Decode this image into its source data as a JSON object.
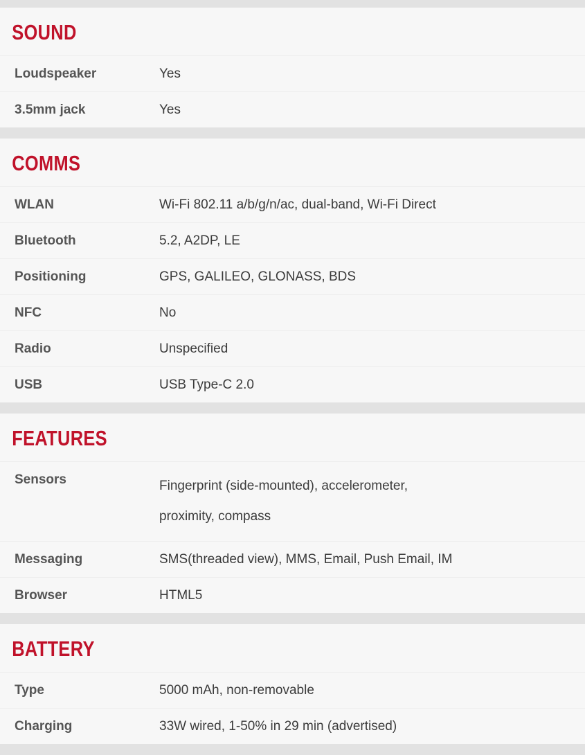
{
  "theme": {
    "accent_red": "#c0122a",
    "row_bg": "#f7f7f7",
    "gap_bg": "#e2e2e2",
    "label_color": "#555555",
    "value_color": "#3b3b3b",
    "divider_color": "#ededed"
  },
  "sections": [
    {
      "title": "SOUND",
      "rows": [
        {
          "label": "Loudspeaker",
          "value": "Yes"
        },
        {
          "label": "3.5mm jack",
          "value": "Yes"
        }
      ]
    },
    {
      "title": "COMMS",
      "rows": [
        {
          "label": "WLAN",
          "value": "Wi-Fi 802.11 a/b/g/n/ac, dual-band, Wi-Fi Direct"
        },
        {
          "label": "Bluetooth",
          "value": "5.2, A2DP, LE"
        },
        {
          "label": "Positioning",
          "value": "GPS, GALILEO, GLONASS, BDS"
        },
        {
          "label": "NFC",
          "value": "No"
        },
        {
          "label": "Radio",
          "value": "Unspecified"
        },
        {
          "label": "USB",
          "value": "USB Type-C 2.0"
        }
      ]
    },
    {
      "title": "FEATURES",
      "rows": [
        {
          "label": "Sensors",
          "value": "Fingerprint (side-mounted), accelerometer,\nproximity, compass"
        },
        {
          "label": "Messaging",
          "value": "SMS(threaded view), MMS, Email, Push Email, IM"
        },
        {
          "label": "Browser",
          "value": "HTML5"
        }
      ]
    },
    {
      "title": "BATTERY",
      "rows": [
        {
          "label": "Type",
          "value": "5000 mAh, non-removable"
        },
        {
          "label": "Charging",
          "value": "33W wired, 1-50% in 29 min (advertised)"
        }
      ]
    }
  ]
}
